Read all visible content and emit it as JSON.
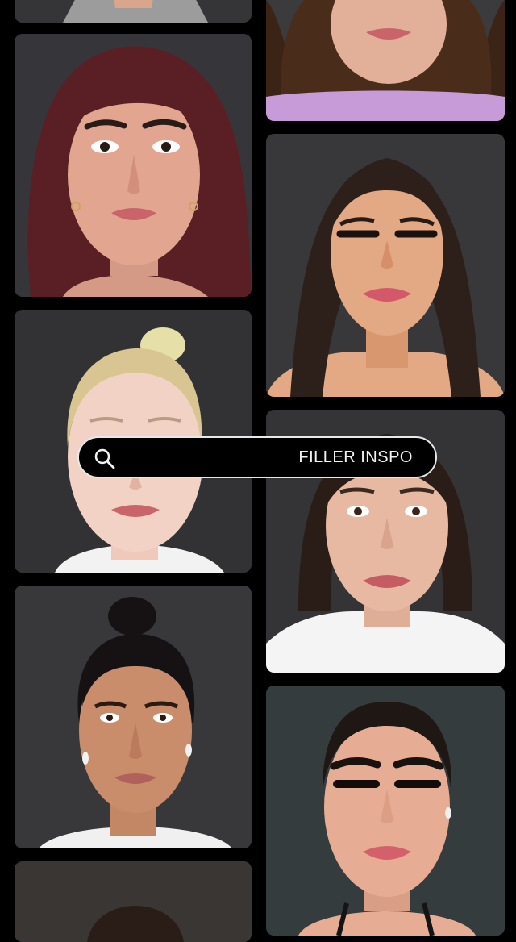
{
  "search": {
    "text": "FILLER INSPO",
    "icon": "search-icon"
  },
  "grid": {
    "left_column": [
      {
        "hair": "#d8cfc6",
        "skin": "#d9a58c",
        "shirt": "#9c9c9c"
      },
      {
        "hair": "#5a1f24",
        "skin": "#e2a58f",
        "shirt": "#e2a58f"
      },
      {
        "hair": "#e6dfa8",
        "skin": "#f2d2c4",
        "shirt": "#f2f2f2"
      },
      {
        "hair": "#161214",
        "skin": "#c98d6c",
        "shirt": "#f0f0f0"
      },
      {
        "hair": "#2a1c16",
        "skin": "#c99a80",
        "shirt": "#2a2a2a"
      }
    ],
    "right_column": [
      {
        "hair": "#3b2416",
        "skin": "#e2b098",
        "shirt": "#c79ad8"
      },
      {
        "hair": "#2d1f19",
        "skin": "#e3a884",
        "shirt": "#e3a884"
      },
      {
        "hair": "#2a1d17",
        "skin": "#e7b9a3",
        "shirt": "#f4f4f4"
      },
      {
        "hair": "#1f1713",
        "skin": "#e6ad94",
        "shirt": "#141414"
      }
    ]
  },
  "colors": {
    "background": "#000000",
    "tile_background": "#343437",
    "search_border": "#e8e8e8",
    "lips": "#c9646b"
  }
}
